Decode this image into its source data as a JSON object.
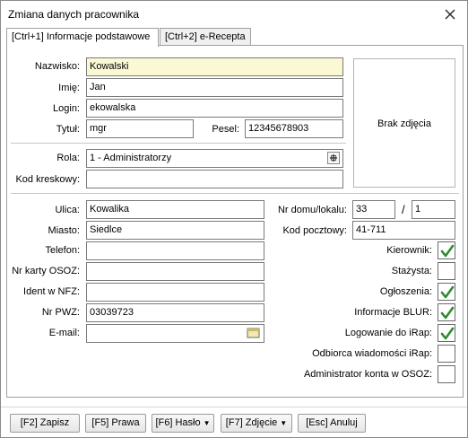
{
  "window": {
    "title": "Zmiana danych pracownika"
  },
  "tabs": [
    {
      "label": "[Ctrl+1] Informacje podstawowe",
      "active": true
    },
    {
      "label": "[Ctrl+2] e-Recepta",
      "active": false
    }
  ],
  "form": {
    "nazwisko": {
      "label": "Nazwisko:",
      "value": "Kowalski"
    },
    "imie": {
      "label": "Imię:",
      "value": "Jan"
    },
    "login": {
      "label": "Login:",
      "value": "ekowalska"
    },
    "tytul": {
      "label": "Tytuł:",
      "value": "mgr"
    },
    "pesel": {
      "label": "Pesel:",
      "value": "12345678903"
    },
    "rola": {
      "label": "Rola:",
      "value": "1 - Administratorzy"
    },
    "kod_kreskowy": {
      "label": "Kod kreskowy:",
      "value": ""
    },
    "ulica": {
      "label": "Ulica:",
      "value": "Kowalika"
    },
    "miasto": {
      "label": "Miasto:",
      "value": "Siedlce"
    },
    "telefon": {
      "label": "Telefon:",
      "value": ""
    },
    "nr_karty_osoz": {
      "label": "Nr karty OSOZ:",
      "value": ""
    },
    "ident_nfz": {
      "label": "Ident w NFZ:",
      "value": ""
    },
    "nr_pwz": {
      "label": "Nr PWZ:",
      "value": "03039723"
    },
    "email": {
      "label": "E-mail:",
      "value": ""
    },
    "nr_domu": {
      "label": "Nr domu/lokalu:",
      "value": "33",
      "separator": "/",
      "lokal": "1"
    },
    "kod_pocztowy": {
      "label": "Kod pocztowy:",
      "value": "41-711"
    }
  },
  "photo": {
    "text": "Brak zdjęcia"
  },
  "checkboxes": [
    {
      "label": "Kierownik:",
      "checked": true
    },
    {
      "label": "Stażysta:",
      "checked": false
    },
    {
      "label": "Ogłoszenia:",
      "checked": true
    },
    {
      "label": "Informacje BLUR:",
      "checked": true
    },
    {
      "label": "Logowanie do iRap:",
      "checked": true
    },
    {
      "label": "Odbiorca wiadomości iRap:",
      "checked": false
    },
    {
      "label": "Administrator konta w OSOZ:",
      "checked": false
    }
  ],
  "buttons": {
    "save": "[F2] Zapisz",
    "rights": "[F5] Prawa",
    "password": "[F6] Hasło",
    "photo": "[F7] Zdjęcie",
    "cancel": "[Esc] Anuluj"
  },
  "colors": {
    "check_green": "#2e8b2e",
    "highlight_field": "#fbf8d4"
  }
}
